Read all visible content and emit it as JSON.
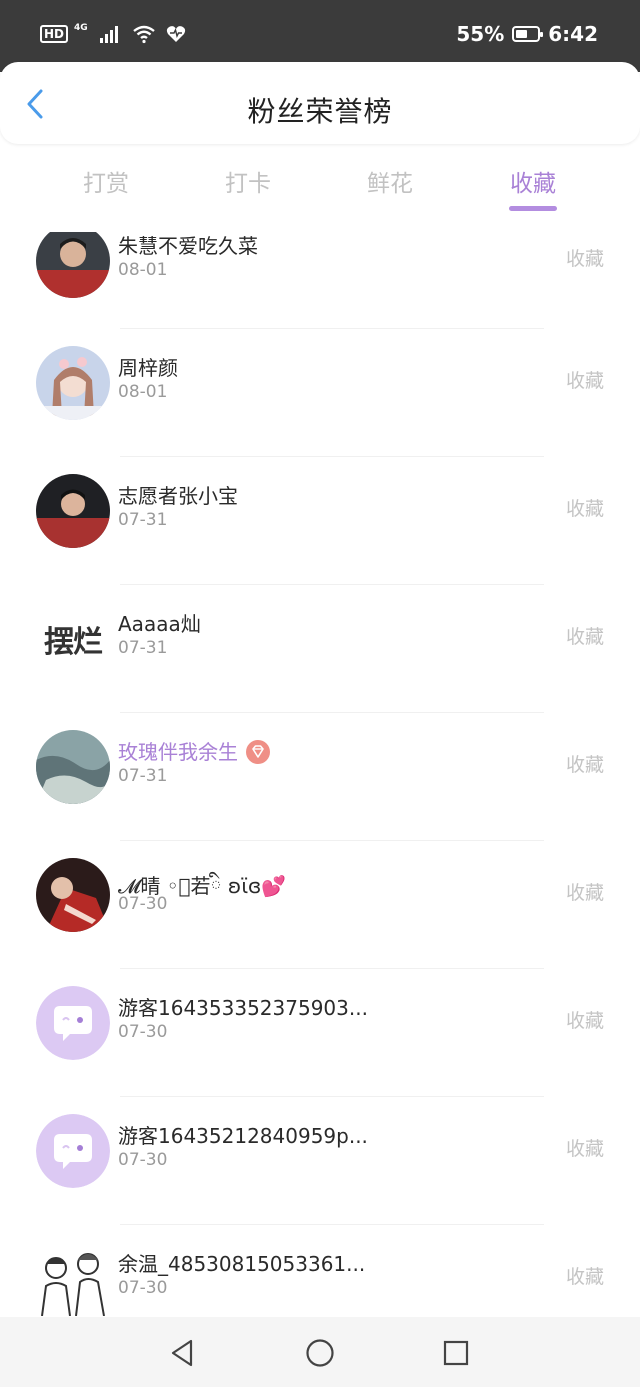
{
  "status_bar": {
    "hd": "HD",
    "network": "4G",
    "battery_percent": "55%",
    "battery_level": 0.55,
    "time": "6:42"
  },
  "header": {
    "title": "粉丝荣誉榜",
    "back_icon": "chevron-left-icon"
  },
  "tabs": [
    {
      "label": "打赏",
      "active": false
    },
    {
      "label": "打卡",
      "active": false
    },
    {
      "label": "鲜花",
      "active": false
    },
    {
      "label": "收藏",
      "active": true
    }
  ],
  "colors": {
    "accent": "#a981d6",
    "status_bar": "#3b3b3b",
    "muted": "#c4c4c4"
  },
  "rows": [
    {
      "name": "朱慧不爱吃久菜",
      "date": "08-01",
      "action": "收藏",
      "avatar": "photo-boy-red-jersey"
    },
    {
      "name": "周梓颜",
      "date": "08-01",
      "action": "收藏",
      "avatar": "photo-girl-flowers"
    },
    {
      "name": "志愿者张小宝",
      "date": "07-31",
      "action": "收藏",
      "avatar": "photo-boy-red-jersey"
    },
    {
      "name": "Aaaaa灿",
      "date": "07-31",
      "action": "收藏",
      "avatar": "text-avatar",
      "avatar_text": "摆烂"
    },
    {
      "name": "玫瑰伴我余生",
      "date": "07-31",
      "action": "收藏",
      "avatar": "photo-landscape",
      "vip": true,
      "badge_icon": "gem-badge-icon"
    },
    {
      "name": "𝓜晴 ◦゚若ི ʚϊɞ💕",
      "date": "07-30",
      "action": "收藏",
      "avatar": "photo-red-dark"
    },
    {
      "name": "游客164353352375903...",
      "date": "07-30",
      "action": "收藏",
      "avatar": "default-chat-avatar"
    },
    {
      "name": "游客16435212840959p...",
      "date": "07-30",
      "action": "收藏",
      "avatar": "default-chat-avatar"
    },
    {
      "name": "余温_48530815053361...",
      "date": "07-30",
      "action": "收藏",
      "avatar": "sketch-duo"
    }
  ],
  "nav_bar": {
    "back_icon": "triangle-back-icon",
    "home_icon": "circle-home-icon",
    "recents_icon": "square-recents-icon"
  }
}
